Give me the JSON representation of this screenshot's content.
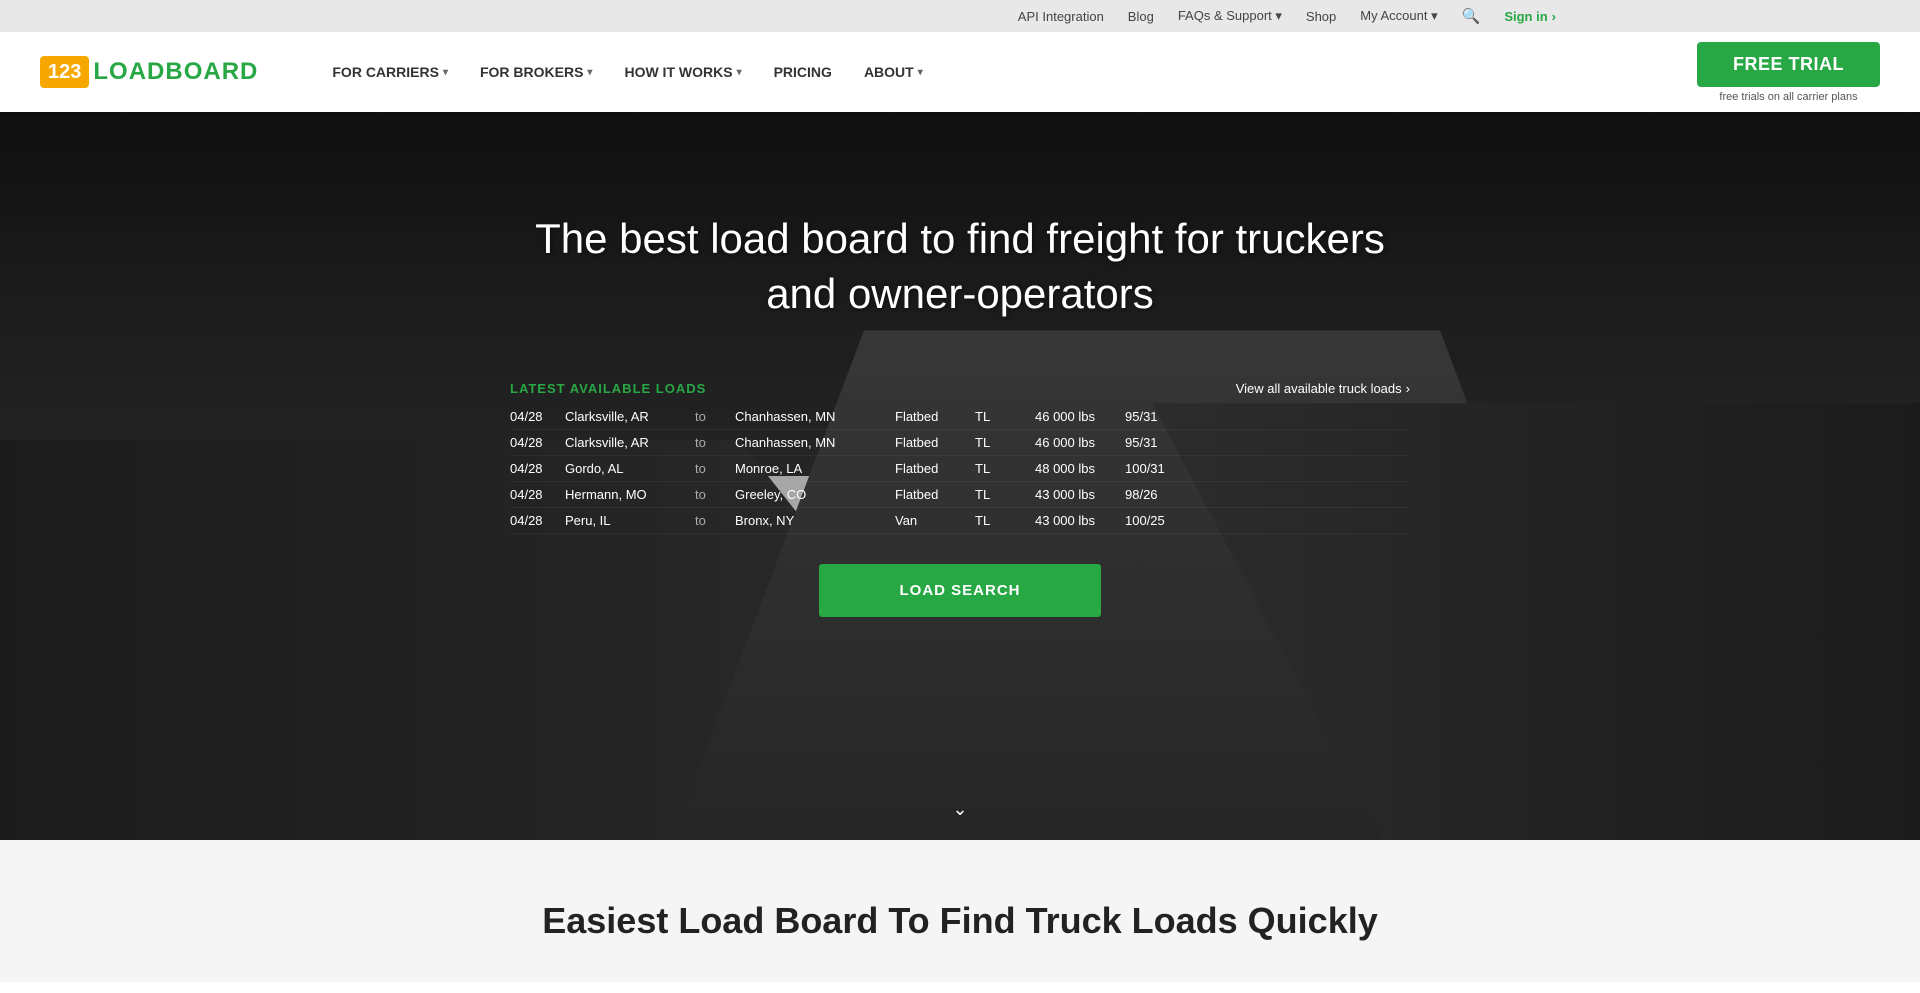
{
  "topBar": {
    "links": [
      {
        "label": "API Integration",
        "href": "#"
      },
      {
        "label": "Blog",
        "href": "#"
      },
      {
        "label": "FAQs & Support",
        "href": "#",
        "hasDropdown": true
      },
      {
        "label": "Shop",
        "href": "#"
      },
      {
        "label": "My Account",
        "href": "#",
        "hasDropdown": true
      }
    ],
    "signin": "Sign in",
    "signinArrow": "›"
  },
  "nav": {
    "logo123": "123",
    "logoText": "LOADBOARD",
    "items": [
      {
        "label": "FOR CARRIERS",
        "hasDropdown": true
      },
      {
        "label": "FOR BROKERS",
        "hasDropdown": true
      },
      {
        "label": "HOW IT WORKS",
        "hasDropdown": true
      },
      {
        "label": "PRICING",
        "hasDropdown": false
      },
      {
        "label": "ABOUT",
        "hasDropdown": true
      }
    ],
    "cta": {
      "button": "FREE TRIAL",
      "subtitle": "free trials on all carrier plans"
    }
  },
  "hero": {
    "title_line1": "The best load board to find freight for truckers",
    "title_line2": "and owner-operators",
    "loads_label": "LATEST AVAILABLE LOADS",
    "view_all": "View all available truck loads",
    "loads": [
      {
        "date": "04/28",
        "from": "Clarksville, AR",
        "to": "to",
        "dest": "Chanhassen, MN",
        "type": "Flatbed",
        "mode": "TL",
        "weight": "46 000 lbs",
        "rate": "95/31"
      },
      {
        "date": "04/28",
        "from": "Clarksville, AR",
        "to": "to",
        "dest": "Chanhassen, MN",
        "type": "Flatbed",
        "mode": "TL",
        "weight": "46 000 lbs",
        "rate": "95/31"
      },
      {
        "date": "04/28",
        "from": "Gordo, AL",
        "to": "to",
        "dest": "Monroe, LA",
        "type": "Flatbed",
        "mode": "TL",
        "weight": "48 000 lbs",
        "rate": "100/31"
      },
      {
        "date": "04/28",
        "from": "Hermann, MO",
        "to": "to",
        "dest": "Greeley, CO",
        "type": "Flatbed",
        "mode": "TL",
        "weight": "43 000 lbs",
        "rate": "98/26"
      },
      {
        "date": "04/28",
        "from": "Peru, IL",
        "to": "to",
        "dest": "Bronx, NY",
        "type": "Van",
        "mode": "TL",
        "weight": "43 000 lbs",
        "rate": "100/25"
      }
    ],
    "load_search_btn": "LOAD SEARCH",
    "scroll_arrow": "⌄"
  },
  "bottom": {
    "title": "Easiest Load Board To Find Truck Loads Quickly"
  }
}
